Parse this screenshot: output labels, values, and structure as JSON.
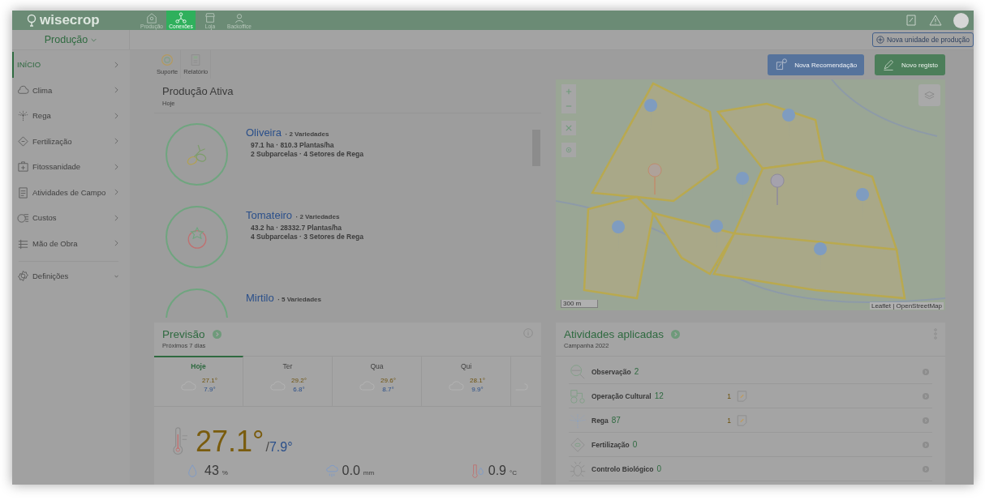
{
  "header": {
    "logo": "wisecrop",
    "apps": [
      {
        "label": "Produção",
        "kind": "farm",
        "selected": false
      },
      {
        "label": "Conexões",
        "kind": "network",
        "selected": true
      },
      {
        "label": "Loja",
        "kind": "shop",
        "selected": false
      },
      {
        "label": "Backoffice",
        "kind": "worker",
        "selected": false
      }
    ]
  },
  "subbar": {
    "unit_selector": "Produção",
    "new_unit_button": "Nova unidade de produção"
  },
  "sidebar": {
    "items": [
      {
        "label": "INÍCIO",
        "kind": "home",
        "selected": true
      },
      {
        "label": "Clima",
        "kind": "weather",
        "selected": false
      },
      {
        "label": "Rega",
        "kind": "irrigation",
        "selected": false
      },
      {
        "label": "Fertilização",
        "kind": "fertilization",
        "selected": false
      },
      {
        "label": "Fitossanidade",
        "kind": "phyto",
        "selected": false
      },
      {
        "label": "Atividades de Campo",
        "kind": "fieldwork",
        "selected": false
      },
      {
        "label": "Custos",
        "kind": "costs",
        "selected": false
      },
      {
        "label": "Mão de Obra",
        "kind": "labor",
        "selected": false
      },
      {
        "label": "Definições",
        "kind": "settings",
        "selected": false
      }
    ]
  },
  "toolbar": [
    {
      "label": "Suporte",
      "kind": "support"
    },
    {
      "label": "Relatório",
      "kind": "report"
    }
  ],
  "actions": [
    "Nova Recomendação",
    "Novo registo"
  ],
  "production": {
    "title": "Produção Ativa",
    "subtitle": "Hoje",
    "crops": [
      {
        "name": "Oliveira",
        "varieties": "· 2 Variedades",
        "area": "97.1 ha · 810.3 Plantas/ha",
        "parcels": "2 Subparcelas · 4 Setores de Rega",
        "kind": "olive"
      },
      {
        "name": "Tomateiro",
        "varieties": "· 2 Variedades",
        "area": "43.2 ha · 28332.7 Plantas/ha",
        "parcels": "4 Subparcelas · 3 Setores de Rega",
        "kind": "tomato"
      },
      {
        "name": "Mirtilo",
        "varieties": "· 5 Variedades",
        "kind": "blueberry"
      }
    ]
  },
  "map": {
    "scale": "300 m",
    "attribution": "Leaflet | OpenStreetMap"
  },
  "forecast": {
    "title": "Previsão",
    "subtitle": "Próximos 7 dias",
    "days": [
      {
        "label": "Hoje",
        "high": "27.1°",
        "low": "7.9°",
        "selected": true
      },
      {
        "label": "Ter",
        "high": "29.2°",
        "low": "6.8°",
        "selected": false
      },
      {
        "label": "Qua",
        "high": "29.6°",
        "low": "8.7°",
        "selected": false
      },
      {
        "label": "Qui",
        "high": "28.1°",
        "low": "9.9°",
        "selected": false
      }
    ],
    "current": {
      "high": "27.1°",
      "separator": "/",
      "low": "7.9°"
    },
    "stats": [
      {
        "kind": "humidity",
        "value": "43",
        "unit": "%"
      },
      {
        "kind": "rain",
        "value": "0.0",
        "unit": "mm"
      },
      {
        "kind": "dewpoint",
        "value": "0.9",
        "unit": "°C"
      }
    ]
  },
  "activities": {
    "title": "Atividades aplicadas",
    "subtitle": "Campanha 2022",
    "rows": [
      {
        "label": "Observação",
        "count": "2",
        "kind": "observation"
      },
      {
        "label": "Operação Cultural",
        "count": "12",
        "pending": "1",
        "kind": "tractor"
      },
      {
        "label": "Rega",
        "count": "87",
        "pending": "1",
        "kind": "irrigation"
      },
      {
        "label": "Fertilização",
        "count": "0",
        "kind": "fertilization"
      },
      {
        "label": "Controlo Biológico",
        "count": "0",
        "kind": "bug"
      }
    ]
  }
}
